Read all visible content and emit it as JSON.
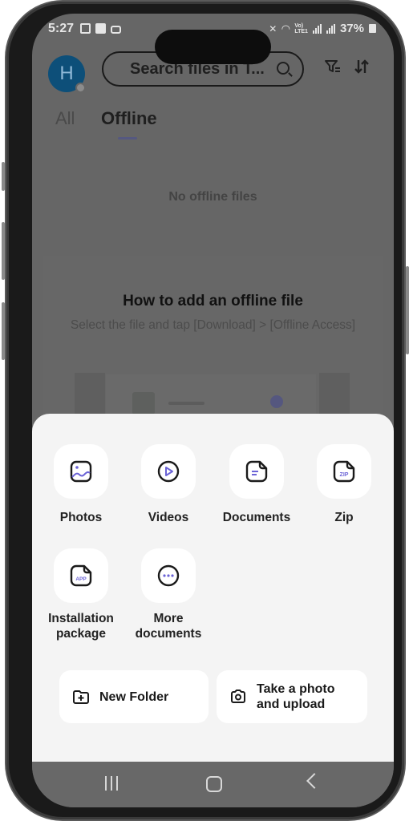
{
  "status_bar": {
    "time": "5:27",
    "left_icons": [
      "gallery-icon",
      "check-icon",
      "lock-icon"
    ],
    "right_icons": [
      "mute-icon",
      "wifi-icon",
      "volte-icon",
      "signal-icon",
      "signal-icon"
    ],
    "battery": "37%"
  },
  "header": {
    "avatar_initial": "H",
    "search_placeholder": "Search files in T...",
    "search_icon": "search-icon",
    "filter_icon": "filter-icon",
    "sort_icon": "sort-icon"
  },
  "tabs": [
    {
      "label": "All",
      "active": false
    },
    {
      "label": "Offline",
      "active": true
    }
  ],
  "main": {
    "empty_message": "No offline files",
    "howto_title": "How to add an offline file",
    "howto_subtitle": "Select the file and tap [Download] > [Offline Access]"
  },
  "sheet": {
    "items": [
      {
        "label": "Photos",
        "icon": "photo-icon"
      },
      {
        "label": "Videos",
        "icon": "video-icon"
      },
      {
        "label": "Documents",
        "icon": "document-icon"
      },
      {
        "label": "Zip",
        "icon": "zip-icon",
        "badge": "ZIP"
      },
      {
        "label": "Installation package",
        "icon": "app-package-icon",
        "badge": "APP"
      },
      {
        "label": "More documents",
        "icon": "more-icon"
      }
    ],
    "actions": [
      {
        "label": "New Folder",
        "icon": "new-folder-icon"
      },
      {
        "label": "Take a photo and upload",
        "icon": "camera-icon"
      }
    ]
  },
  "nav_bar": {
    "recent": "recent-apps-icon",
    "home": "home-icon",
    "back": "back-icon"
  },
  "colors": {
    "accent": "#6b63d6",
    "avatar": "#0d4f79",
    "scrim": "#666666",
    "sheet_bg": "#f4f4f4"
  }
}
